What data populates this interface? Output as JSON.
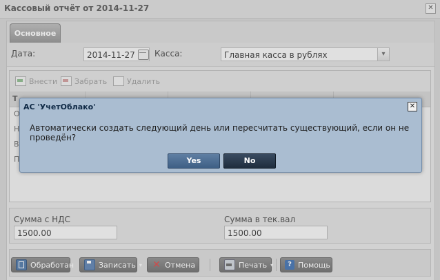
{
  "window": {
    "title": "Кассовый отчёт от 2014-11-27"
  },
  "tabs": [
    {
      "label": "Основное"
    }
  ],
  "form": {
    "date_label": "Дата:",
    "date_value": "2014-11-27",
    "kassa_label": "Касса:",
    "kassa_value": "Главная касса в рублях"
  },
  "grid": {
    "toolbar": {
      "add": "Внести",
      "take": "Забрать",
      "delete": "Удалить"
    },
    "header_first": "Т",
    "row_letters": [
      "О",
      "Н",
      "В",
      "П"
    ]
  },
  "sums": {
    "vat_label": "Сумма с НДС",
    "vat_value": "1500.00",
    "cur_label": "Сумма в тек.вал",
    "cur_value": "1500.00"
  },
  "buttons": {
    "processed": "Обработан",
    "save": "Записать",
    "cancel": "Отмена",
    "print": "Печать",
    "help": "Помощь"
  },
  "dialog": {
    "title": "АС 'УчетОблако'",
    "message": "Автоматически создать следующий день или пересчитать существующий, если он не проведён?",
    "yes": "Yes",
    "no": "No"
  },
  "icons": {
    "close": "close-icon",
    "calendar": "calendar-icon",
    "dropdown": "chevron-down-icon",
    "processed": "document-check-icon",
    "save": "floppy-disk-icon",
    "cancel": "x-icon",
    "print": "printer-icon",
    "help": "question-icon"
  },
  "colors": {
    "dialog_bg": "#aabdd1",
    "yes_btn": "#4c6d93",
    "no_btn": "#2b3a4d",
    "button_bar": "#7a7a7a"
  }
}
